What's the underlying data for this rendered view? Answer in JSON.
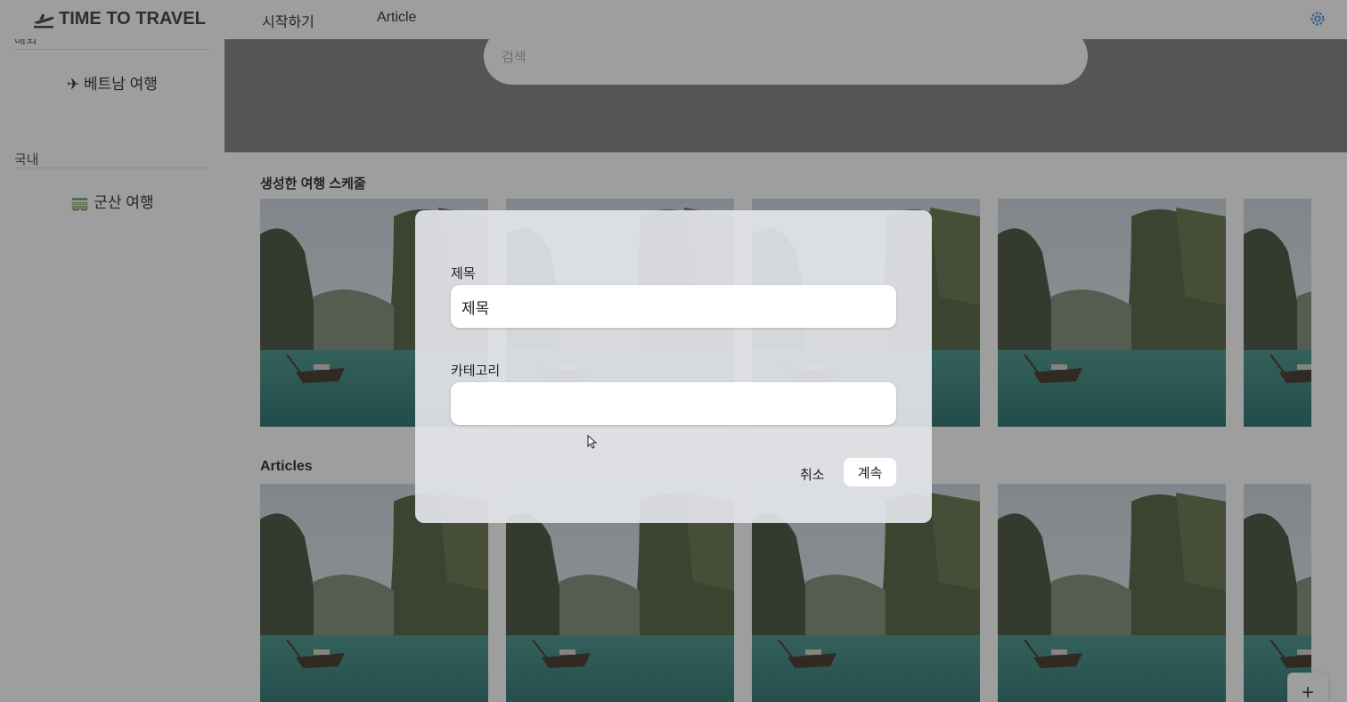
{
  "header": {
    "brand": "TIME TO TRAVEL",
    "nav": [
      "시작하기",
      "Article"
    ]
  },
  "sidebar": {
    "cut_label": "해외",
    "overseas_item": "✈ 베트남 여행",
    "domestic_label": "국내",
    "domestic_item": "🚃 군산 여행"
  },
  "search": {
    "placeholder": "검색"
  },
  "sections": {
    "schedules_title": "생성한 여행 스케줄",
    "articles_title": "Articles"
  },
  "fab_label": "+",
  "dialog": {
    "title_label": "제목",
    "title_value": "제목",
    "category_label": "카테고리",
    "category_value": "",
    "cancel_label": "취소",
    "continue_label": "계속"
  }
}
